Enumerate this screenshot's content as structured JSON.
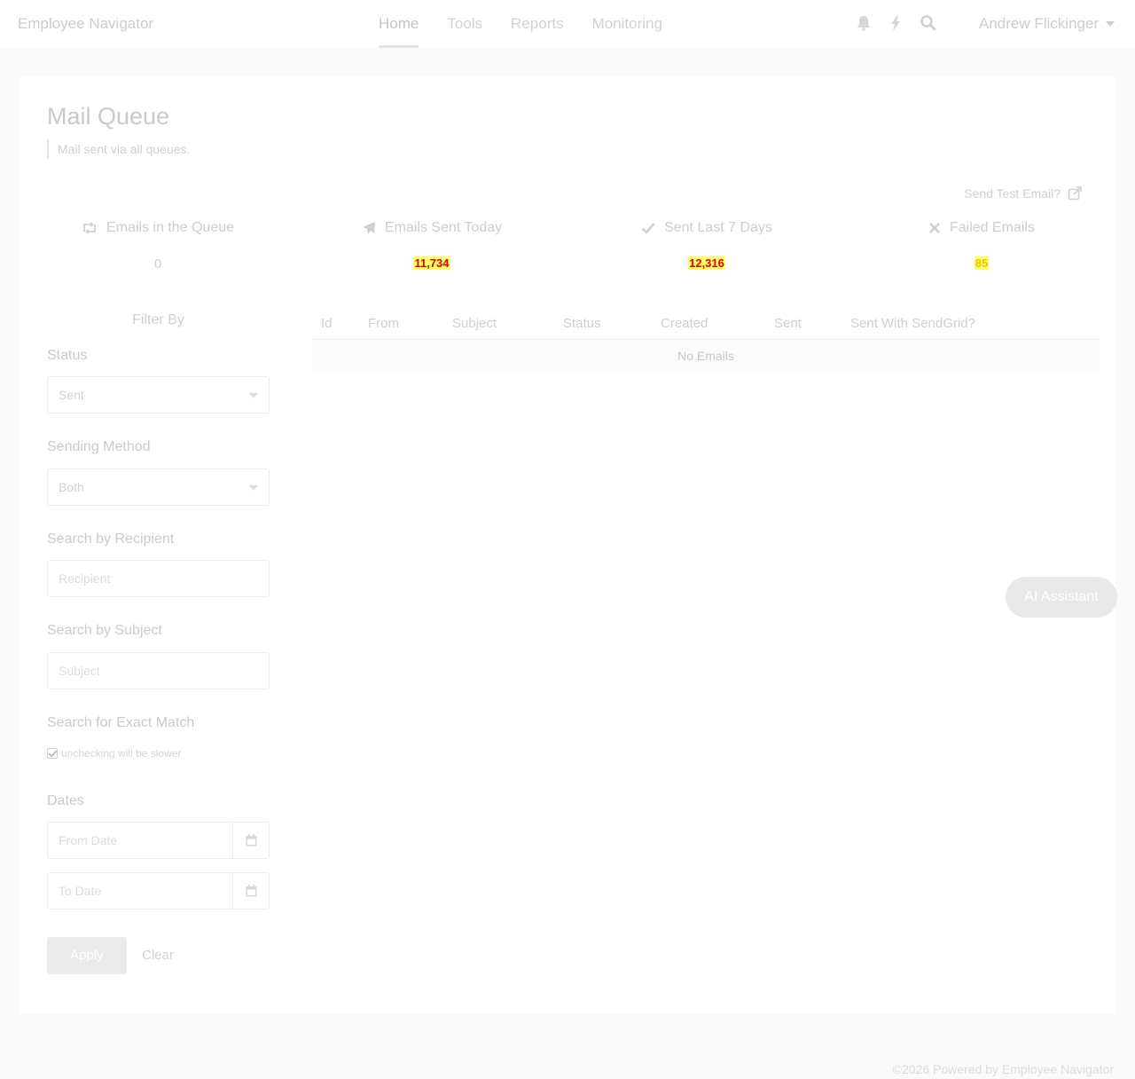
{
  "nav": {
    "brand": "Employee Navigator",
    "links": [
      {
        "label": "Home",
        "active": true
      },
      {
        "label": "Tools"
      },
      {
        "label": "Reports"
      },
      {
        "label": "Monitoring"
      }
    ],
    "icons": [
      "bell-icon",
      "bolt-icon",
      "search-icon"
    ],
    "user": "Andrew Flickinger"
  },
  "page": {
    "title": "Mail Queue",
    "subtitle": "Mail sent via all queues.",
    "test_email_link": "Send Test Email?"
  },
  "stats": [
    {
      "icon": "retweet-icon",
      "label": "Emails in the Queue",
      "value": "0"
    },
    {
      "icon": "paper-plane-icon",
      "label": "Emails Sent Today",
      "value": "11,734"
    },
    {
      "icon": "check-icon",
      "label": "Sent Last 7 Days",
      "value": "12,316"
    },
    {
      "icon": "times-icon",
      "label": "Failed Emails",
      "value": "85"
    }
  ],
  "filter": {
    "title": "Filter By",
    "status_label": "Status",
    "status_value": "Sent",
    "method_label": "Sending Method",
    "method_value": "Both",
    "recipient_label": "Search by Recipient",
    "recipient_placeholder": "Recipient",
    "subject_label": "Search by Subject",
    "subject_placeholder": "Subject",
    "exact_label": "Search for Exact Match",
    "exact_hint": "unchecking will be slower",
    "exact_checked": true,
    "dates_label": "Dates",
    "from_placeholder": "From Date",
    "to_placeholder": "To Date",
    "apply_label": "Apply",
    "clear_label": "Clear"
  },
  "table": {
    "columns": [
      "Id",
      "From",
      "Subject",
      "Status",
      "Created",
      "Sent",
      "Sent With SendGrid?"
    ],
    "empty_text": "No Emails"
  },
  "ai_button": "AI Assistant",
  "footer": "©2026 Powered by Employee Navigator"
}
